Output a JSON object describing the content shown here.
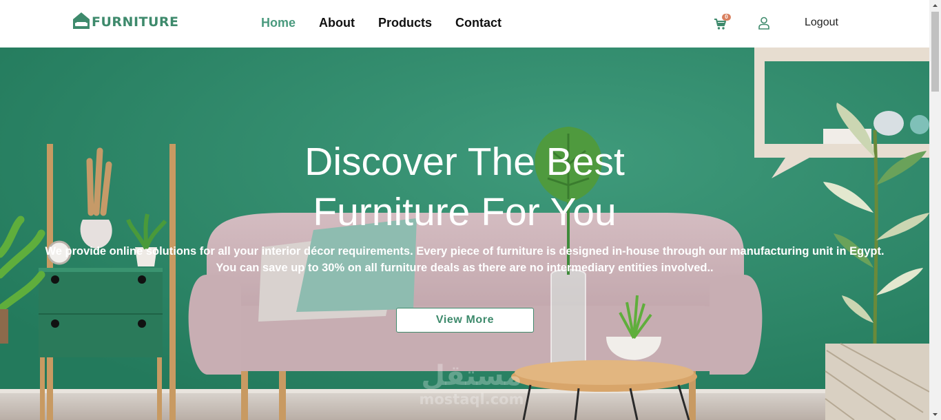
{
  "brand": {
    "name": "FURNITURE",
    "color": "#3e8a6c"
  },
  "nav": {
    "items": [
      {
        "label": "Home",
        "active": true
      },
      {
        "label": "About",
        "active": false
      },
      {
        "label": "Products",
        "active": false
      },
      {
        "label": "Contact",
        "active": false
      }
    ],
    "cart_count": "0",
    "logout_label": "Logout"
  },
  "hero": {
    "title_line1": "Discover The Best",
    "title_line2": "Furniture For You",
    "text_line1": "We provide online solutions for all your interior décor requirements. Every piece of furniture is designed in-house through our manufacturing unit in Egypt.",
    "text_line2": "You can save up to 30% on all furniture deals as there are no intermediary entities involved..",
    "button_label": "View More",
    "background_color": "#2f8a6c"
  },
  "watermark": {
    "arabic": "مستقل",
    "latin": "mostaql.com"
  },
  "icons": [
    "home-logo-icon",
    "cart-icon",
    "user-icon",
    "scroll-up-arrow-icon",
    "scroll-down-arrow-icon"
  ]
}
